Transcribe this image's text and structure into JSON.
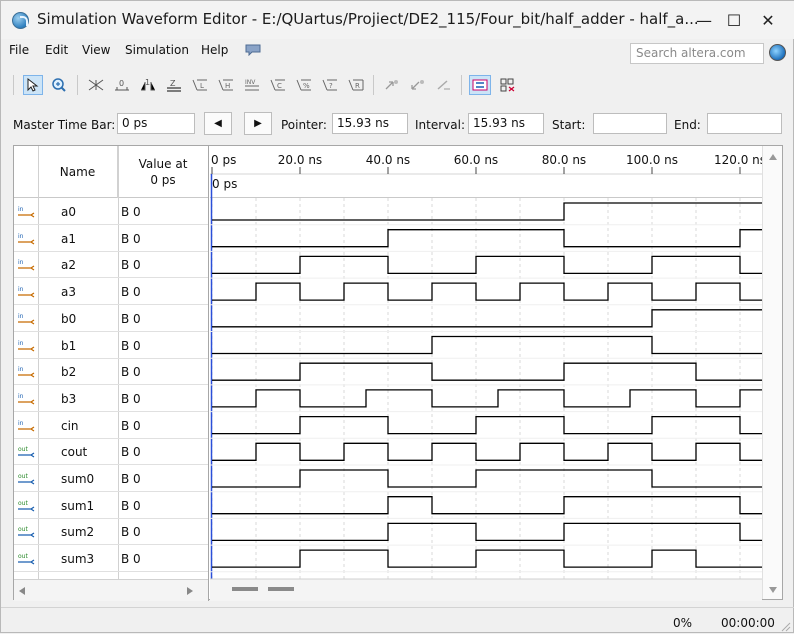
{
  "window": {
    "title": "Simulation Waveform Editor - E:/QUartus/Projiect/DE2_115/Four_bit/half_adder - half_a...",
    "minimize": "—",
    "maximize": "☐",
    "close": "✕"
  },
  "menu": [
    "File",
    "Edit",
    "View",
    "Simulation",
    "Help"
  ],
  "search": {
    "placeholder": "Search altera.com"
  },
  "toolbar": {
    "icons": [
      "pointer-icon",
      "zoom-icon",
      "dont-care-icon",
      "force-low-icon",
      "force-high-icon",
      "high-z-icon",
      "weak-low-icon",
      "weak-high-icon",
      "invert-icon",
      "count-value-icon",
      "overwrite-clock-icon",
      "random-value-icon",
      "arbitrary-value-icon",
      "snap-to-grid-icon",
      "expand-icon",
      "collapse-icon",
      "grid-icon",
      "node-finder-icon"
    ]
  },
  "timebar": {
    "master_label": "Master Time Bar:",
    "master_value": "0 ps",
    "prev": "◀",
    "next": "▶",
    "pointer_label": "Pointer:",
    "pointer_value": "15.93 ns",
    "interval_label": "Interval:",
    "interval_value": "15.93 ns",
    "start_label": "Start:",
    "start_value": "",
    "end_label": "End:",
    "end_value": ""
  },
  "table": {
    "col_name": "Name",
    "col_value": "Value at\n0 ps"
  },
  "signals": [
    {
      "dir": "in",
      "name": "a0",
      "value": "B 0",
      "wave": [
        [
          0,
          0
        ],
        [
          80,
          1
        ]
      ]
    },
    {
      "dir": "in",
      "name": "a1",
      "value": "B 0",
      "wave": [
        [
          0,
          0
        ],
        [
          40,
          1
        ],
        [
          80,
          0
        ],
        [
          120,
          1
        ]
      ]
    },
    {
      "dir": "in",
      "name": "a2",
      "value": "B 0",
      "wave": [
        [
          0,
          0
        ],
        [
          20,
          1
        ],
        [
          40,
          0
        ],
        [
          60,
          1
        ],
        [
          80,
          0
        ],
        [
          100,
          1
        ],
        [
          120,
          0
        ]
      ]
    },
    {
      "dir": "in",
      "name": "a3",
      "value": "B 0",
      "wave": [
        [
          0,
          0
        ],
        [
          10,
          1
        ],
        [
          20,
          0
        ],
        [
          30,
          1
        ],
        [
          40,
          0
        ],
        [
          50,
          1
        ],
        [
          60,
          0
        ],
        [
          70,
          1
        ],
        [
          80,
          0
        ],
        [
          90,
          1
        ],
        [
          100,
          0
        ],
        [
          110,
          1
        ],
        [
          120,
          0
        ]
      ]
    },
    {
      "dir": "in",
      "name": "b0",
      "value": "B 0",
      "wave": [
        [
          0,
          0
        ],
        [
          100,
          1
        ]
      ]
    },
    {
      "dir": "in",
      "name": "b1",
      "value": "B 0",
      "wave": [
        [
          0,
          0
        ],
        [
          50,
          1
        ],
        [
          100,
          0
        ]
      ]
    },
    {
      "dir": "in",
      "name": "b2",
      "value": "B 0",
      "wave": [
        [
          0,
          0
        ],
        [
          20,
          1
        ],
        [
          50,
          0
        ],
        [
          80,
          1
        ],
        [
          110,
          0
        ]
      ]
    },
    {
      "dir": "in",
      "name": "b3",
      "value": "B 0",
      "wave": [
        [
          0,
          0
        ],
        [
          10,
          1
        ],
        [
          20,
          0
        ],
        [
          35,
          1
        ],
        [
          50,
          0
        ],
        [
          65,
          1
        ],
        [
          80,
          0
        ],
        [
          95,
          1
        ],
        [
          110,
          0
        ],
        [
          120,
          1
        ]
      ]
    },
    {
      "dir": "in",
      "name": "cin",
      "value": "B 0",
      "wave": [
        [
          0,
          0
        ],
        [
          20,
          1
        ],
        [
          40,
          0
        ],
        [
          60,
          1
        ],
        [
          80,
          0
        ],
        [
          100,
          1
        ],
        [
          120,
          0
        ]
      ]
    },
    {
      "dir": "out",
      "name": "cout",
      "value": "B 0",
      "wave": [
        [
          0,
          0
        ],
        [
          10,
          1
        ],
        [
          20,
          0
        ],
        [
          30,
          1
        ],
        [
          40,
          0
        ],
        [
          50,
          1
        ],
        [
          60,
          0
        ],
        [
          70,
          1
        ],
        [
          80,
          0
        ],
        [
          90,
          1
        ],
        [
          100,
          0
        ],
        [
          110,
          1
        ],
        [
          120,
          0
        ]
      ]
    },
    {
      "dir": "out",
      "name": "sum0",
      "value": "B 0",
      "wave": [
        [
          0,
          0
        ],
        [
          20,
          1
        ],
        [
          40,
          0
        ],
        [
          60,
          1
        ],
        [
          100,
          0
        ]
      ]
    },
    {
      "dir": "out",
      "name": "sum1",
      "value": "B 0",
      "wave": [
        [
          0,
          0
        ],
        [
          40,
          1
        ],
        [
          50,
          0
        ],
        [
          80,
          1
        ],
        [
          120,
          0
        ]
      ]
    },
    {
      "dir": "out",
      "name": "sum2",
      "value": "B 0",
      "wave": [
        [
          0,
          0
        ],
        [
          40,
          1
        ],
        [
          60,
          0
        ],
        [
          80,
          1
        ],
        [
          120,
          0
        ]
      ]
    },
    {
      "dir": "out",
      "name": "sum3",
      "value": "B 0",
      "wave": [
        [
          0,
          0
        ],
        [
          20,
          1
        ],
        [
          40,
          0
        ],
        [
          60,
          1
        ],
        [
          80,
          0
        ],
        [
          100,
          1
        ],
        [
          110,
          0
        ]
      ]
    }
  ],
  "timeline": {
    "ticks": [
      {
        "t": 0,
        "label": "0 ps"
      },
      {
        "t": 20,
        "label": "20.0 ns"
      },
      {
        "t": 40,
        "label": "40.0 ns"
      },
      {
        "t": 60,
        "label": "60.0 ns"
      },
      {
        "t": 80,
        "label": "80.0 ns"
      },
      {
        "t": 100,
        "label": "100.0 ns"
      },
      {
        "t": 120,
        "label": "120.0 ns"
      }
    ],
    "cursor_label": "0 ps",
    "t_max": 125
  },
  "status": {
    "progress": "0%",
    "time": "00:00:00"
  },
  "colors": {
    "wave": "#000000",
    "cursor": "#2a4fd8",
    "grid": "#cfcfcf"
  }
}
